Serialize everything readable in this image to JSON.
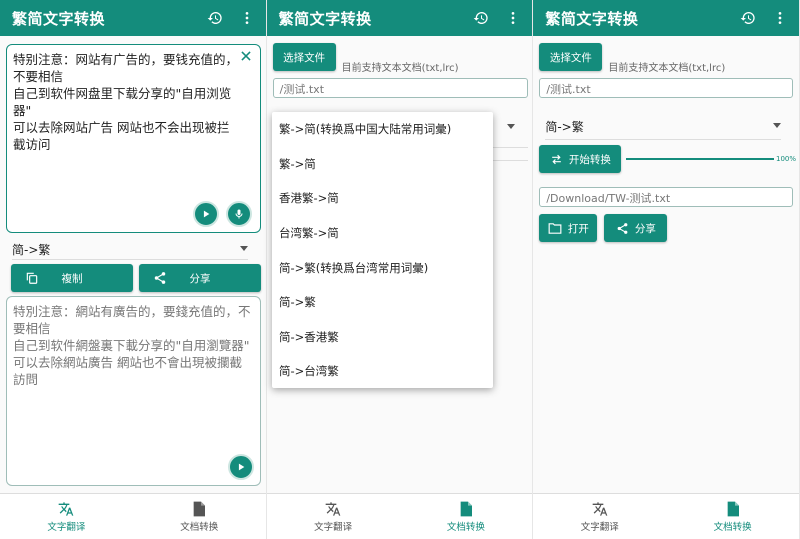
{
  "app": {
    "title": "繁简文字转换"
  },
  "colors": {
    "primary": "#148c7c"
  },
  "icons": {
    "history": "history-icon",
    "more": "more-vert-icon"
  },
  "screen1": {
    "input_text": "特别注意：网站有广告的，要钱充值的，不要相信\n自己到软件网盘里下载分享的\"自用浏览器\"\n可以去除网站广告 网站也不会出现被拦截访问",
    "mode": "简->繁",
    "copy_label": "複制",
    "share_label": "分享",
    "output_text": "特別注意：網站有廣告的，要錢充值的，不要相信\n自己到软件網盤裏下載分享的\"自用瀏覽器\"\n可以去除網站廣告 網站也不會出現被攔截訪問"
  },
  "screen2": {
    "choose_label": "选择文件",
    "hint": "目前支持文本文档(txt,lrc)",
    "file_path": "/测试.txt",
    "options": [
      "繁->简(转换爲中国大陆常用词彙)",
      "繁->简",
      "香港繁->简",
      "台湾繁->简",
      "简->繁(转换爲台湾常用词彙)",
      "简->繁",
      "简->香港繁",
      "简->台湾繁"
    ]
  },
  "screen3": {
    "choose_label": "选择文件",
    "hint": "目前支持文本文档(txt,lrc)",
    "file_path": "/测试.txt",
    "mode": "简->繁",
    "start_label": "开始转换",
    "progress": 1.0,
    "progress_label": "100%",
    "output_path": "/Download/TW-测试.txt",
    "open_label": "打开",
    "share_label": "分享"
  },
  "nav": {
    "text_translate": "文字翻译",
    "doc_convert": "文档转换"
  }
}
